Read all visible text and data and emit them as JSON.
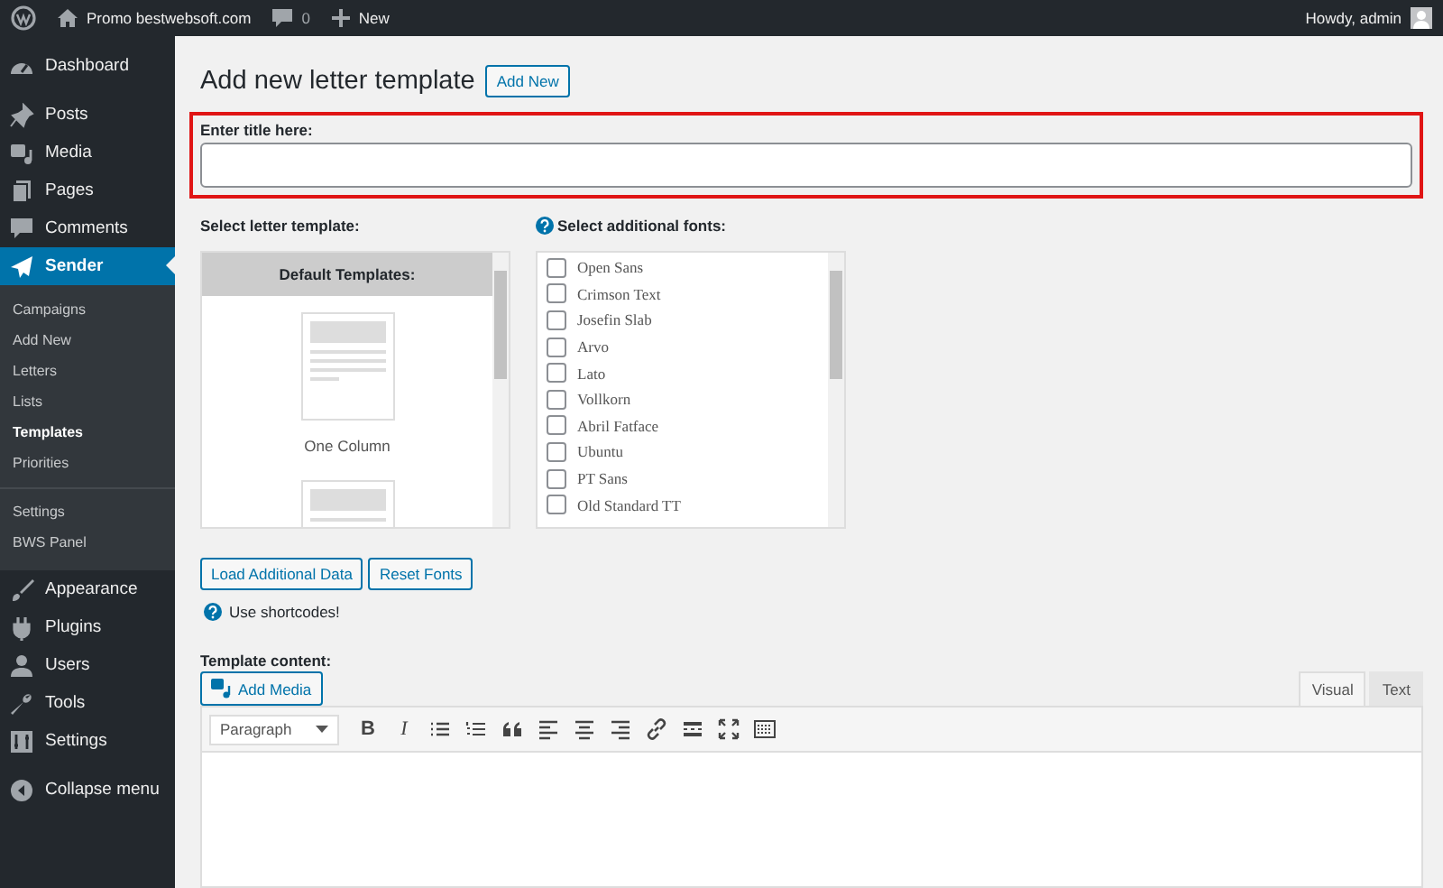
{
  "admin_bar": {
    "site": "Promo bestwebsoft.com",
    "comments": "0",
    "new": "New",
    "greeting": "Howdy, admin"
  },
  "sidebar": {
    "groups": [
      {
        "items": [
          {
            "label": "Dashboard",
            "selected": false
          }
        ]
      },
      {
        "items": [
          {
            "label": "Posts",
            "selected": false
          },
          {
            "label": "Media",
            "selected": false
          },
          {
            "label": "Pages",
            "selected": false
          },
          {
            "label": "Comments",
            "selected": false
          },
          {
            "label": "Sender",
            "selected": true,
            "expanded": true,
            "children": [
              {
                "label": "Campaigns",
                "selected": false,
                "divider_before": false
              },
              {
                "label": "Add New",
                "selected": false,
                "divider_before": false
              },
              {
                "label": "Letters",
                "selected": false,
                "divider_before": false
              },
              {
                "label": "Lists",
                "selected": false,
                "divider_before": false
              },
              {
                "label": "Templates",
                "selected": true,
                "divider_before": false
              },
              {
                "label": "Priorities",
                "selected": false,
                "divider_before": false
              },
              {
                "label": "Settings",
                "selected": false,
                "divider_before": true
              },
              {
                "label": "BWS Panel",
                "selected": false,
                "divider_before": false
              }
            ]
          },
          {
            "label": "Appearance",
            "selected": false
          },
          {
            "label": "Plugins",
            "selected": false
          },
          {
            "label": "Users",
            "selected": false
          },
          {
            "label": "Tools",
            "selected": false
          },
          {
            "label": "Settings",
            "selected": false
          }
        ]
      }
    ],
    "collapse": "Collapse menu"
  },
  "page": {
    "heading": "Add new letter template",
    "add_new": "Add New"
  },
  "title_field": {
    "label": "Enter title here:",
    "highlighted": true
  },
  "template_picker": {
    "label": "Select letter template:",
    "group_title": "Default Templates:",
    "templates": [
      {
        "label": "One Column"
      }
    ]
  },
  "fonts": {
    "label": "Select additional fonts:",
    "items": [
      {
        "label": "Open Sans",
        "checked": false
      },
      {
        "label": "Crimson Text",
        "checked": false
      },
      {
        "label": "Josefin Slab",
        "checked": false
      },
      {
        "label": "Arvo",
        "checked": false
      },
      {
        "label": "Lato",
        "checked": false
      },
      {
        "label": "Vollkorn",
        "checked": false
      },
      {
        "label": "Abril Fatface",
        "checked": false
      },
      {
        "label": "Ubuntu",
        "checked": false
      },
      {
        "label": "PT Sans",
        "checked": false
      },
      {
        "label": "Old Standard TT",
        "checked": false
      }
    ]
  },
  "buttons": [
    "Load Additional Data",
    "Reset Fonts"
  ],
  "hint": "Use shortcodes!",
  "editor": {
    "label": "Template content:",
    "add_media": "Add Media",
    "tabs": [
      {
        "label": "Visual",
        "selected": true
      },
      {
        "label": "Text",
        "selected": false
      }
    ],
    "format": "Paragraph",
    "toolbar": [
      {
        "kind": "bold",
        "glyph": "B"
      },
      {
        "kind": "italic",
        "glyph": "I"
      },
      {
        "kind": "bullets"
      },
      {
        "kind": "numbers"
      },
      {
        "kind": "quote"
      },
      {
        "kind": "align-left"
      },
      {
        "kind": "align-center"
      },
      {
        "kind": "align-right"
      },
      {
        "kind": "link"
      },
      {
        "kind": "more"
      },
      {
        "kind": "fullscreen"
      },
      {
        "kind": "toolbar-toggle"
      }
    ]
  }
}
